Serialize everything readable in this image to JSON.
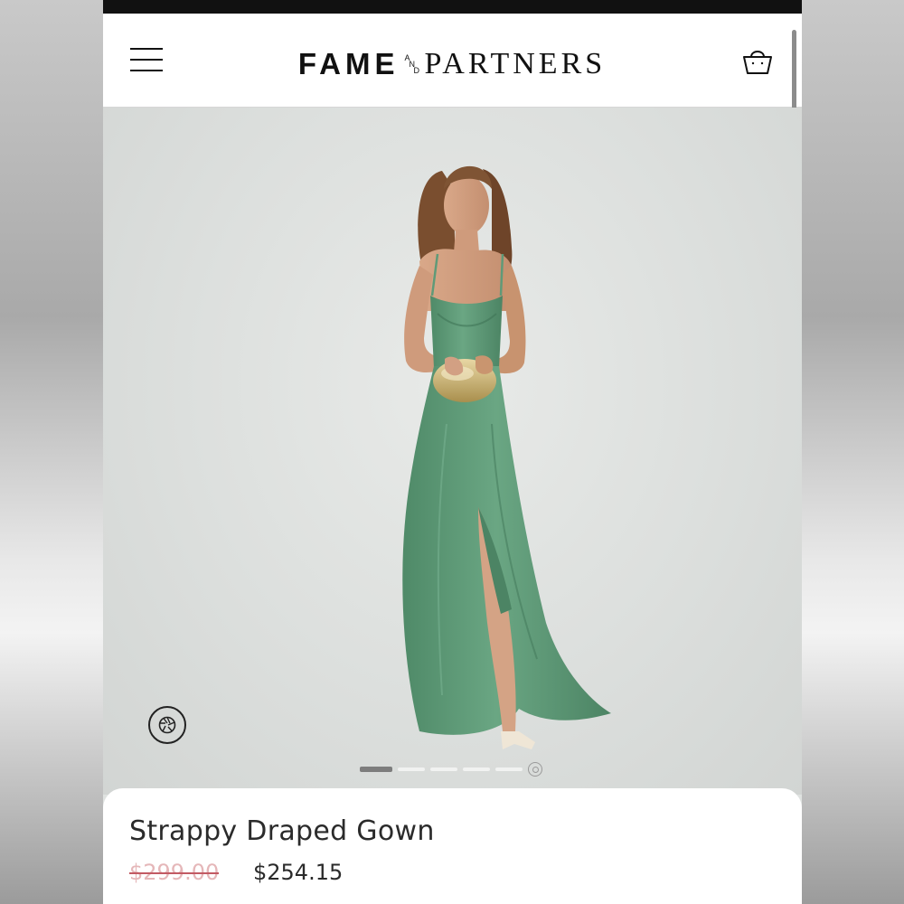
{
  "header": {
    "menu_icon": "hamburger-menu-icon",
    "logo": {
      "word1": "FAME",
      "and_letters": [
        "A",
        "N",
        "D"
      ],
      "word2": "PARTNERS"
    },
    "cart_icon": "shopping-bag-icon"
  },
  "hero": {
    "view_360_icon": "360-camera-icon",
    "carousel": {
      "total_slides": 5,
      "active_index": 0,
      "last_icon": "camera-icon"
    },
    "dress_color": "#5f9a78"
  },
  "product": {
    "title": "Strappy Draped Gown",
    "original_price": "$299.00",
    "sale_price": "$254.15"
  },
  "colors": {
    "original_price_text": "#e5b7b9",
    "strike_line": "#c25a63"
  }
}
